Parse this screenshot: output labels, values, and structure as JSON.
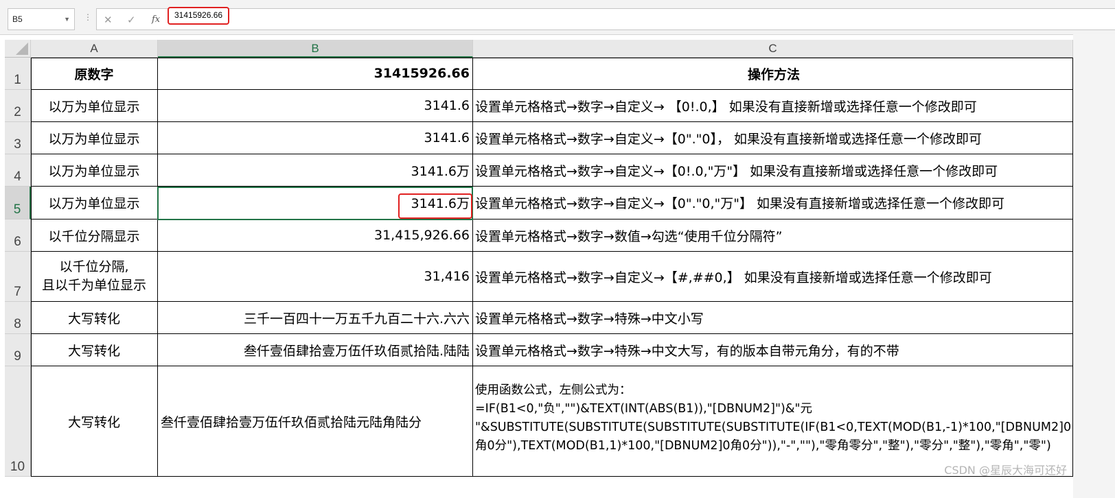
{
  "formula_bar": {
    "name_box": "B5",
    "formula_value": "31415926.66",
    "icons": [
      "cancel-icon",
      "confirm-icon",
      "function-icon"
    ]
  },
  "columns": [
    "A",
    "B",
    "C"
  ],
  "rows": [
    {
      "num": "1",
      "a": "原数字",
      "b": "31415926.66",
      "c": "操作方法"
    },
    {
      "num": "2",
      "a": "以万为单位显示",
      "b": "3141.6",
      "c": "设置单元格格式→数字→自定义→ 【0!.0,】      如果没有直接新增或选择任意一个修改即可"
    },
    {
      "num": "3",
      "a": "以万为单位显示",
      "b": "3141.6",
      "c": "设置单元格格式→数字→自定义→【0\".\"0】，     如果没有直接新增或选择任意一个修改即可"
    },
    {
      "num": "4",
      "a": "以万为单位显示",
      "b": "3141.6万",
      "c": "设置单元格格式→数字→自定义→【0!.0,\"万\"】      如果没有直接新增或选择任意一个修改即可"
    },
    {
      "num": "5",
      "a": "以万为单位显示",
      "b": "3141.6万",
      "c": "设置单元格格式→数字→自定义→【0\".\"0,\"万\"】      如果没有直接新增或选择任意一个修改即可"
    },
    {
      "num": "6",
      "a": "以千位分隔显示",
      "b": "31,415,926.66",
      "c": "设置单元格格式→数字→数值→勾选“使用千位分隔符”"
    },
    {
      "num": "7",
      "a": "以千位分隔,\n且以千为单位显示",
      "b": "31,416",
      "c": "设置单元格格式→数字→自定义→【#,##0,】      如果没有直接新增或选择任意一个修改即可"
    },
    {
      "num": "8",
      "a": "大写转化",
      "b": "三千一百四十一万五千九百二十六.六六",
      "c": "设置单元格格式→数字→特殊→中文小写"
    },
    {
      "num": "9",
      "a": "大写转化",
      "b": "叁仟壹佰肆拾壹万伍仟玖佰贰拾陆.陆陆",
      "c": "设置单元格格式→数字→特殊→中文大写，有的版本自带元角分，有的不带"
    },
    {
      "num": "10",
      "a": "大写转化",
      "b": "叁仟壹佰肆拾壹万伍仟玖佰贰拾陆元陆角陆分",
      "c": "使用函数公式，左侧公式为：\n=IF(B1<0,\"负\",\"\")&TEXT(INT(ABS(B1)),\"[DBNUM2]\")&\"元\n\"&SUBSTITUTE(SUBSTITUTE(SUBSTITUTE(SUBSTITUTE(IF(B1<0,TEXT(MOD(B1,-1)*100,\"[DBNUM2]0\n角0分\"),TEXT(MOD(B1,1)*100,\"[DBNUM2]0角0分\")),\"-\",\"\"),\"零角零分\",\"整\"),\"零分\",\"整\"),\"零角\",\"零\")"
    }
  ],
  "selected_cell": "B5",
  "watermark": "CSDN @星辰大海可还好",
  "colors": {
    "selection": "#217346",
    "highlight": "#e02020"
  }
}
